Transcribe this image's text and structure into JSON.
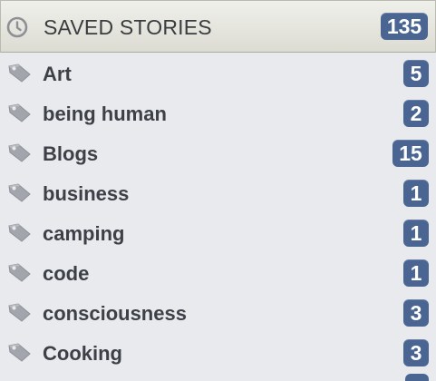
{
  "header": {
    "title": "SAVED STORIES",
    "count": "135",
    "icon": "clock-icon"
  },
  "tags": [
    {
      "label": "Art",
      "count": "5"
    },
    {
      "label": "being human",
      "count": "2"
    },
    {
      "label": "Blogs",
      "count": "15"
    },
    {
      "label": "business",
      "count": "1"
    },
    {
      "label": "camping",
      "count": "1"
    },
    {
      "label": "code",
      "count": "1"
    },
    {
      "label": "consciousness",
      "count": "3"
    },
    {
      "label": "Cooking",
      "count": "3"
    }
  ],
  "colors": {
    "badge": "#4a6592",
    "background": "#e8eaee",
    "header": "#e6e6df"
  }
}
